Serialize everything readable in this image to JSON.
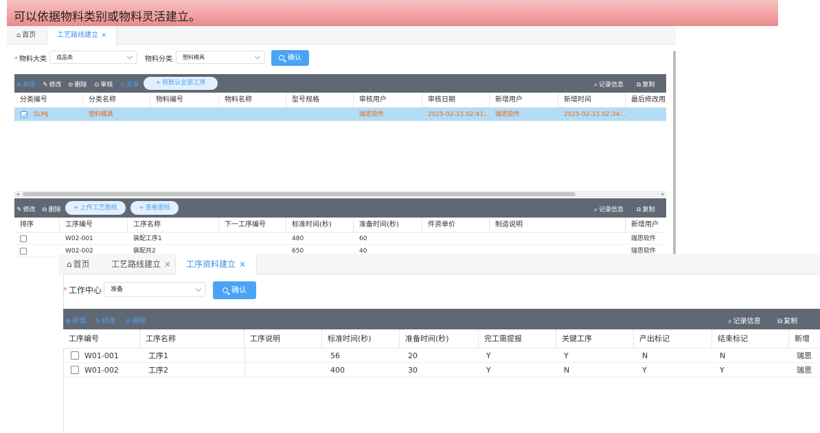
{
  "banner": {
    "text": "可以依据物料类别或物料灵活建立。"
  },
  "window1": {
    "tabs": [
      {
        "label": "首页",
        "icon": "home-icon",
        "closable": false,
        "active": false
      },
      {
        "label": "工艺路线建立",
        "closable": true,
        "active": true
      }
    ],
    "filters": {
      "category_label": "物料大类",
      "category_value": "成品类",
      "class_label": "物料分类",
      "class_value": "塑料模具",
      "confirm_label": "确认"
    },
    "toolbar": {
      "add": "新增",
      "edit": "修改",
      "delete": "删除",
      "audit": "审核",
      "unaudit": "反审",
      "convert": "转默认全部工序",
      "records": "记录信息",
      "copy": "复制"
    },
    "grid": {
      "columns": [
        "分类编号",
        "分类名称",
        "物料编号",
        "物料名称",
        "型号规格",
        "审核用户",
        "审核日期",
        "新增用户",
        "新增时间",
        "最后修改用户"
      ],
      "rows": [
        {
          "checked": true,
          "code": "SLMJ",
          "name": "塑料模具",
          "material_code": "",
          "material_name": "",
          "spec": "",
          "audit_user": "瑞思软件",
          "audit_date": "2025-02-15 02:41:...",
          "add_user": "瑞思软件",
          "add_time": "2025-02-15 02:34:...",
          "modify_user": ""
        }
      ]
    },
    "toolbar2": {
      "edit": "修改",
      "delete": "删除",
      "upload": "上传工艺图纸",
      "view": "查看图纸",
      "records": "记录信息",
      "copy": "复制"
    },
    "grid2": {
      "columns": [
        "排序",
        "工序编号",
        "工序名称",
        "下一工序编号",
        "标准时间(秒)",
        "准备时间(秒)",
        "件资单价",
        "制造说明",
        "新增用户"
      ],
      "rows": [
        {
          "code": "W02-001",
          "name": "装配工序1",
          "next": "",
          "std": "480",
          "prep": "60",
          "price": "",
          "note": "",
          "user": "瑞思软件"
        },
        {
          "code": "W02-002",
          "name": "装配共2",
          "next": "",
          "std": "650",
          "prep": "40",
          "price": "",
          "note": "",
          "user": "瑞思软件"
        }
      ]
    }
  },
  "window2": {
    "tabs": [
      {
        "label": "首页",
        "active": false,
        "closable": false
      },
      {
        "label": "工艺路线建立",
        "active": false,
        "closable": true
      },
      {
        "label": "工序资料建立",
        "active": true,
        "closable": true
      }
    ],
    "filters": {
      "center_label": "工作中心",
      "center_value": "准备",
      "confirm_label": "确认"
    },
    "toolbar": {
      "add": "新增",
      "edit": "修改",
      "delete": "删除",
      "records": "记录信息",
      "copy": "复制"
    },
    "grid": {
      "columns": [
        "工序编号",
        "工序名称",
        "工序说明",
        "标准时间(秒)",
        "准备时间(秒)",
        "完工需提报",
        "关键工序",
        "产出标记",
        "结束标记",
        "新增"
      ],
      "rows": [
        {
          "code": "W01-001",
          "name": "工序1",
          "desc": "",
          "std": "56",
          "prep": "20",
          "report": "Y",
          "key": "Y",
          "output": "N",
          "end": "N",
          "user": "瑞思"
        },
        {
          "code": "W01-002",
          "name": "工序2",
          "desc": "",
          "std": "400",
          "prep": "30",
          "report": "Y",
          "key": "N",
          "output": "Y",
          "end": "Y",
          "user": "瑞思"
        }
      ]
    }
  },
  "colors": {
    "accent": "#4aa3f5",
    "toolbar": "#606874",
    "selected_row": "#b3dcf6",
    "highlight_text": "#e56d17"
  }
}
